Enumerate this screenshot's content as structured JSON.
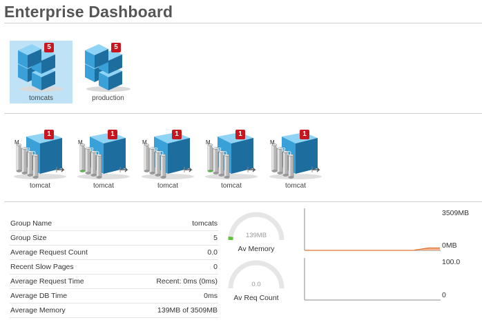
{
  "page": {
    "title": "Enterprise Dashboard"
  },
  "groups": [
    {
      "label": "tomcats",
      "badge": "5",
      "selected": true
    },
    {
      "label": "production",
      "badge": "5",
      "selected": false
    }
  ],
  "servers": [
    {
      "label": "tomcat",
      "badge": "1",
      "letters": [
        "M",
        "C",
        "R",
        "D"
      ],
      "status": "grey"
    },
    {
      "label": "tomcat",
      "badge": "1",
      "letters": [
        "M",
        "C",
        "R",
        "D"
      ],
      "status": "green"
    },
    {
      "label": "tomcat",
      "badge": "1",
      "letters": [
        "M",
        "C",
        "R",
        "D"
      ],
      "status": "grey"
    },
    {
      "label": "tomcat",
      "badge": "1",
      "letters": [
        "M",
        "C",
        "R",
        "D"
      ],
      "status": "green"
    },
    {
      "label": "tomcat",
      "badge": "1",
      "letters": [
        "M",
        "C",
        "R",
        "D"
      ],
      "status": "grey"
    }
  ],
  "stats": [
    {
      "key": "Group Name",
      "value": "tomcats"
    },
    {
      "key": "Group Size",
      "value": "5"
    },
    {
      "key": "Average Request Count",
      "value": "0.0"
    },
    {
      "key": "Recent Slow Pages",
      "value": "0"
    },
    {
      "key": "Average Request Time",
      "value": "Recent: 0ms (0ms)"
    },
    {
      "key": "Average DB Time",
      "value": "0ms"
    },
    {
      "key": "Average Memory",
      "value": "139MB of 3509MB"
    }
  ],
  "gauges": {
    "memory": {
      "value": "139MB",
      "label": "Av Memory",
      "fraction": 0.04
    },
    "requests": {
      "value": "0.0",
      "label": "Av Req Count",
      "fraction": 0.0
    }
  },
  "charts": {
    "memory": {
      "max_label": "3509MB",
      "min_label": "0MB",
      "max": 3509,
      "values": [
        0,
        0,
        0,
        0,
        0,
        0,
        0,
        0,
        0,
        0,
        0,
        0,
        0,
        0,
        0,
        0,
        0,
        0,
        0,
        0,
        0,
        0,
        0,
        0,
        0,
        0,
        0,
        0,
        0,
        0,
        0,
        0,
        0,
        0,
        60,
        90,
        139,
        180,
        200,
        200,
        200,
        200
      ]
    },
    "requests": {
      "max_label": "100.0",
      "min_label": "0",
      "max": 100
    }
  },
  "colors": {
    "accent": "#3aa0d8",
    "badge": "#c8161e",
    "selected": "#bfe2f7",
    "chart_fill": "#f3b48f",
    "chart_line": "#e07030",
    "gauge_ok": "#5ac43a"
  }
}
